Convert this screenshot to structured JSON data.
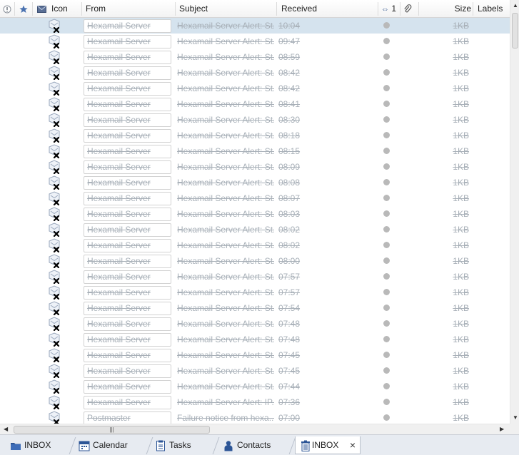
{
  "columns": {
    "priority_icon": "exclamation-circle-icon",
    "flag_icon": "star-icon",
    "read_icon": "envelope-icon",
    "icon": "Icon",
    "from": "From",
    "subject": "Subject",
    "received": "Received",
    "thread": "1",
    "attachment_icon": "paperclip-icon",
    "size": "Size",
    "labels": "Labels"
  },
  "messages": [
    {
      "from": "Hexamail Server",
      "subject": "Hexamail Server Alert: St...",
      "received": "10:04",
      "size": "1KB",
      "selected": true
    },
    {
      "from": "Hexamail Server",
      "subject": "Hexamail Server Alert: St...",
      "received": "09:47",
      "size": "1KB"
    },
    {
      "from": "Hexamail Server",
      "subject": "Hexamail Server Alert: St...",
      "received": "08:59",
      "size": "1KB"
    },
    {
      "from": "Hexamail Server",
      "subject": "Hexamail Server Alert: St...",
      "received": "08:42",
      "size": "1KB"
    },
    {
      "from": "Hexamail Server",
      "subject": "Hexamail Server Alert: St...",
      "received": "08:42",
      "size": "1KB"
    },
    {
      "from": "Hexamail Server",
      "subject": "Hexamail Server Alert: St...",
      "received": "08:41",
      "size": "1KB"
    },
    {
      "from": "Hexamail Server",
      "subject": "Hexamail Server Alert: St...",
      "received": "08:30",
      "size": "1KB"
    },
    {
      "from": "Hexamail Server",
      "subject": "Hexamail Server Alert: St...",
      "received": "08:18",
      "size": "1KB"
    },
    {
      "from": "Hexamail Server",
      "subject": "Hexamail Server Alert: St...",
      "received": "08:15",
      "size": "1KB"
    },
    {
      "from": "Hexamail Server",
      "subject": "Hexamail Server Alert: St...",
      "received": "08:09",
      "size": "1KB"
    },
    {
      "from": "Hexamail Server",
      "subject": "Hexamail Server Alert: St...",
      "received": "08:08",
      "size": "1KB"
    },
    {
      "from": "Hexamail Server",
      "subject": "Hexamail Server Alert: St...",
      "received": "08:07",
      "size": "1KB"
    },
    {
      "from": "Hexamail Server",
      "subject": "Hexamail Server Alert: St...",
      "received": "08:03",
      "size": "1KB"
    },
    {
      "from": "Hexamail Server",
      "subject": "Hexamail Server Alert: St...",
      "received": "08:02",
      "size": "1KB"
    },
    {
      "from": "Hexamail Server",
      "subject": "Hexamail Server Alert: St...",
      "received": "08:02",
      "size": "1KB"
    },
    {
      "from": "Hexamail Server",
      "subject": "Hexamail Server Alert: St...",
      "received": "08:00",
      "size": "1KB"
    },
    {
      "from": "Hexamail Server",
      "subject": "Hexamail Server Alert: St...",
      "received": "07:57",
      "size": "1KB"
    },
    {
      "from": "Hexamail Server",
      "subject": "Hexamail Server Alert: St...",
      "received": "07:57",
      "size": "1KB"
    },
    {
      "from": "Hexamail Server",
      "subject": "Hexamail Server Alert: St...",
      "received": "07:54",
      "size": "1KB"
    },
    {
      "from": "Hexamail Server",
      "subject": "Hexamail Server Alert: St...",
      "received": "07:48",
      "size": "1KB"
    },
    {
      "from": "Hexamail Server",
      "subject": "Hexamail Server Alert: St...",
      "received": "07:48",
      "size": "1KB"
    },
    {
      "from": "Hexamail Server",
      "subject": "Hexamail Server Alert: St...",
      "received": "07:45",
      "size": "1KB"
    },
    {
      "from": "Hexamail Server",
      "subject": "Hexamail Server Alert: St...",
      "received": "07:45",
      "size": "1KB"
    },
    {
      "from": "Hexamail Server",
      "subject": "Hexamail Server Alert: St...",
      "received": "07:44",
      "size": "1KB"
    },
    {
      "from": "Hexamail Server",
      "subject": "Hexamail Server Alert: IP...",
      "received": "07:36",
      "size": "1KB"
    },
    {
      "from": "Postmaster",
      "subject": "Failure notice from hexa...",
      "received": "07:00",
      "size": "1KB"
    }
  ],
  "hscroll": {
    "thumb_grip": "|||"
  },
  "tabs": [
    {
      "label": "INBOX",
      "icon": "folder-icon"
    },
    {
      "label": "Calendar",
      "icon": "calendar-icon"
    },
    {
      "label": "Tasks",
      "icon": "task-list-icon"
    },
    {
      "label": "Contacts",
      "icon": "contact-person-icon"
    },
    {
      "label": "INBOX",
      "icon": "trash-folder-icon",
      "active": true,
      "close": "×"
    }
  ],
  "colors": {
    "selected_row": "#d5e3ee",
    "struck_text": "#a8b0b8",
    "tab_bar": "#e7ebf1"
  }
}
